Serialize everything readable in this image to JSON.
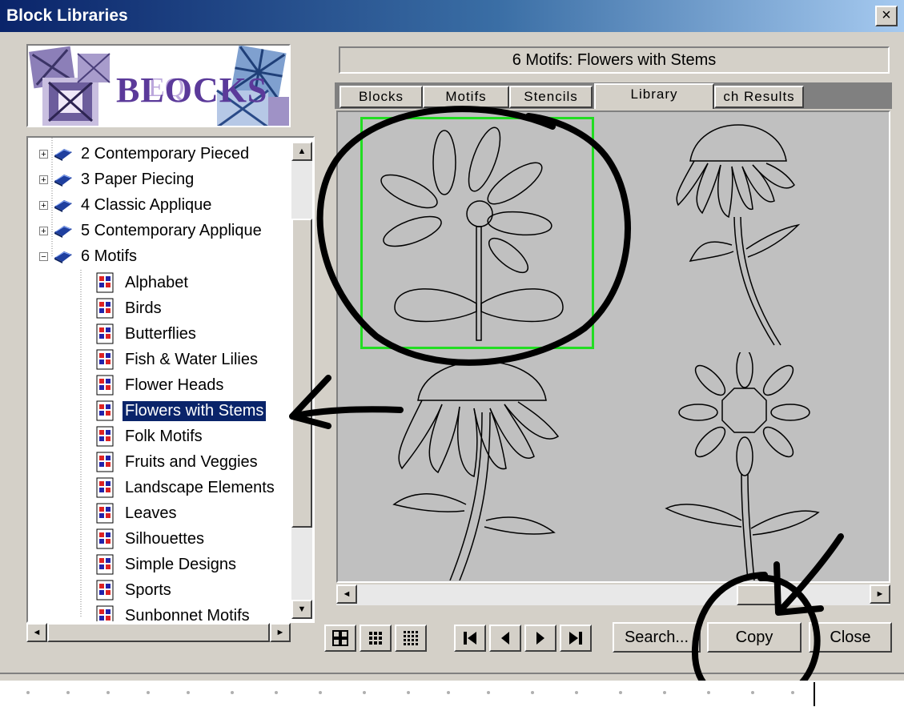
{
  "window": {
    "title": "Block Libraries",
    "close": "×"
  },
  "logo": {
    "text": "BLOCKS",
    "q": "EQ"
  },
  "tree": {
    "items": [
      {
        "label": "2 Contemporary Pieced",
        "kind": "book",
        "expander": "+"
      },
      {
        "label": "3 Paper Piecing",
        "kind": "book",
        "expander": "+"
      },
      {
        "label": "4 Classic Applique",
        "kind": "book",
        "expander": "+"
      },
      {
        "label": "5 Contemporary Applique",
        "kind": "book",
        "expander": "+"
      },
      {
        "label": "6 Motifs",
        "kind": "book",
        "expander": "−"
      },
      {
        "label": "Alphabet",
        "kind": "page"
      },
      {
        "label": "Birds",
        "kind": "page"
      },
      {
        "label": "Butterflies",
        "kind": "page"
      },
      {
        "label": "Fish & Water Lilies",
        "kind": "page"
      },
      {
        "label": "Flower Heads",
        "kind": "page"
      },
      {
        "label": "Flowers with Stems",
        "kind": "page",
        "selected": true
      },
      {
        "label": "Folk Motifs",
        "kind": "page"
      },
      {
        "label": "Fruits and Veggies",
        "kind": "page"
      },
      {
        "label": "Landscape Elements",
        "kind": "page"
      },
      {
        "label": "Leaves",
        "kind": "page"
      },
      {
        "label": "Silhouettes",
        "kind": "page"
      },
      {
        "label": "Simple Designs",
        "kind": "page"
      },
      {
        "label": "Sports",
        "kind": "page"
      },
      {
        "label": "Sunbonnet Motifs",
        "kind": "page"
      }
    ]
  },
  "panel": {
    "header": "6 Motifs:   Flowers with Stems",
    "tabs": [
      {
        "label": "Blocks"
      },
      {
        "label": "Motifs"
      },
      {
        "label": "Stencils"
      },
      {
        "label": "Library",
        "active": true
      },
      {
        "label": "ch Results"
      }
    ]
  },
  "buttons": {
    "search": "Search...",
    "copy": "Copy",
    "close": "Close"
  },
  "arrows": {
    "up": "▲",
    "down": "▼",
    "left": "◄",
    "right": "►"
  },
  "nav": {
    "first": "⏮",
    "prev": "◄",
    "next": "►",
    "last": "⏭"
  },
  "colors": {
    "selection": "#0a246a",
    "gallery_select": "#22dd22",
    "face": "#d4d0c8"
  }
}
